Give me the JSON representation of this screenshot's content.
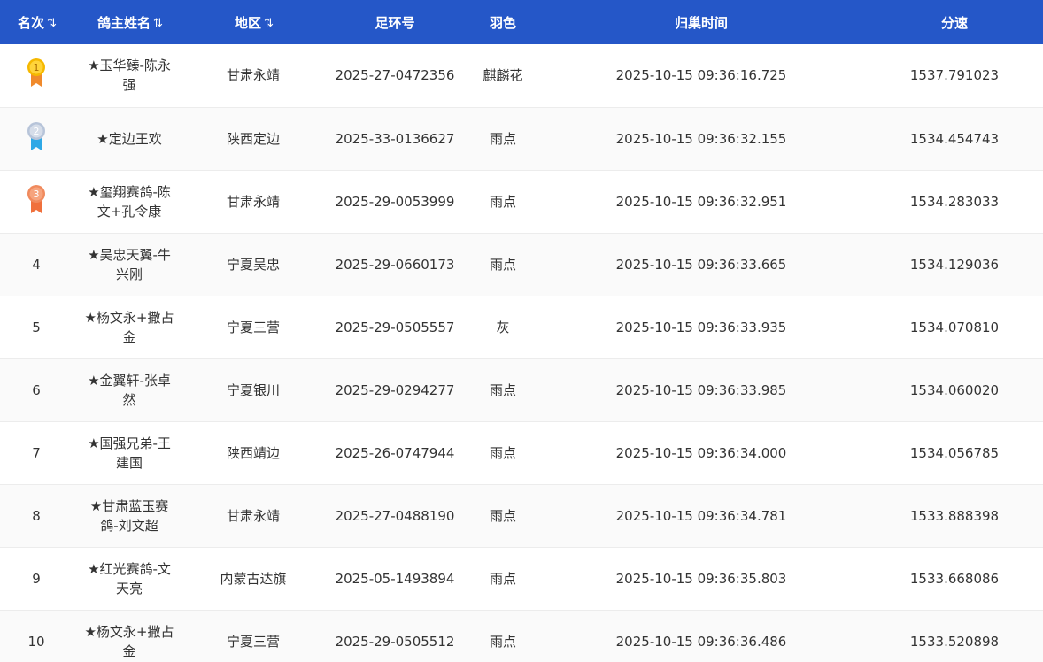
{
  "header": {
    "rank": "名次",
    "owner": "鸽主姓名",
    "region": "地区",
    "ring": "足环号",
    "color": "羽色",
    "time": "归巢时间",
    "speed": "分速",
    "sort_icon": "⇅"
  },
  "medal_colors": {
    "gold": "#f5b800",
    "silver": "#b7c4d9",
    "bronze": "#f08a5d"
  },
  "rows": [
    {
      "rank": "1",
      "owner": "★玉华臻-陈永强",
      "region": "甘肃永靖",
      "ring": "2025-27-0472356",
      "color": "麒麟花",
      "time": "2025-10-15 09:36:16.725",
      "speed": "1537.791023"
    },
    {
      "rank": "2",
      "owner": "★定边王欢",
      "region": "陕西定边",
      "ring": "2025-33-0136627",
      "color": "雨点",
      "time": "2025-10-15 09:36:32.155",
      "speed": "1534.454743"
    },
    {
      "rank": "3",
      "owner": "★玺翔赛鸽-陈文+孔令康",
      "region": "甘肃永靖",
      "ring": "2025-29-0053999",
      "color": "雨点",
      "time": "2025-10-15 09:36:32.951",
      "speed": "1534.283033"
    },
    {
      "rank": "4",
      "owner": "★吴忠天翼-牛兴刚",
      "region": "宁夏吴忠",
      "ring": "2025-29-0660173",
      "color": "雨点",
      "time": "2025-10-15 09:36:33.665",
      "speed": "1534.129036"
    },
    {
      "rank": "5",
      "owner": "★杨文永+撒占金",
      "region": "宁夏三营",
      "ring": "2025-29-0505557",
      "color": "灰",
      "time": "2025-10-15 09:36:33.935",
      "speed": "1534.070810"
    },
    {
      "rank": "6",
      "owner": "★金翼轩-张卓然",
      "region": "宁夏银川",
      "ring": "2025-29-0294277",
      "color": "雨点",
      "time": "2025-10-15 09:36:33.985",
      "speed": "1534.060020"
    },
    {
      "rank": "7",
      "owner": "★国强兄弟-王建国",
      "region": "陕西靖边",
      "ring": "2025-26-0747944",
      "color": "雨点",
      "time": "2025-10-15 09:36:34.000",
      "speed": "1534.056785"
    },
    {
      "rank": "8",
      "owner": "★甘肃蓝玉赛鸽-刘文超",
      "region": "甘肃永靖",
      "ring": "2025-27-0488190",
      "color": "雨点",
      "time": "2025-10-15 09:36:34.781",
      "speed": "1533.888398"
    },
    {
      "rank": "9",
      "owner": "★红光赛鸽-文天亮",
      "region": "内蒙古达旗",
      "ring": "2025-05-1493894",
      "color": "雨点",
      "time": "2025-10-15 09:36:35.803",
      "speed": "1533.668086"
    },
    {
      "rank": "10",
      "owner": "★杨文永+撒占金",
      "region": "宁夏三营",
      "ring": "2025-29-0505512",
      "color": "雨点",
      "time": "2025-10-15 09:36:36.486",
      "speed": "1533.520898"
    }
  ]
}
